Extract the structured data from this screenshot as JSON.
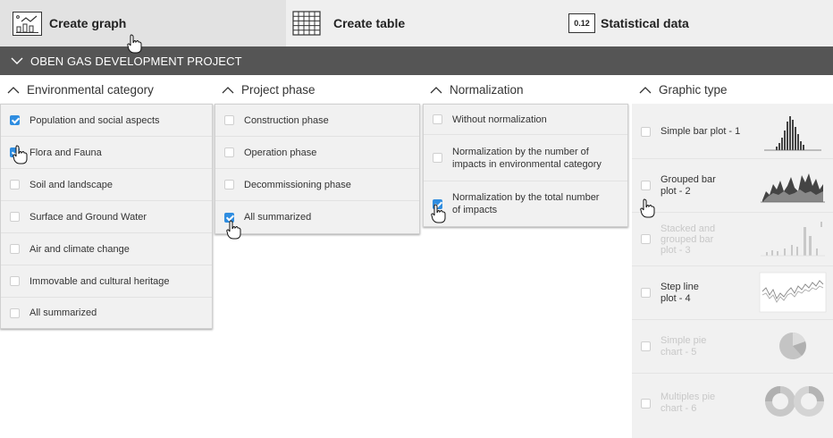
{
  "toolbar": {
    "create_graph": "Create graph",
    "create_table": "Create table",
    "statistical_data": "Statistical data",
    "stat_icon_text": "0.12"
  },
  "project": {
    "title": "OBEN GAS DEVELOPMENT PROJECT"
  },
  "columns": {
    "env": {
      "header": "Environmental category",
      "items": [
        {
          "label": "Population and social aspects",
          "checked": true
        },
        {
          "label": "Flora and Fauna",
          "checked": true
        },
        {
          "label": "Soil and landscape",
          "checked": false
        },
        {
          "label": "Surface and Ground Water",
          "checked": false
        },
        {
          "label": "Air and climate change",
          "checked": false
        },
        {
          "label": "Immovable and cultural heritage",
          "checked": false
        },
        {
          "label": "All summarized",
          "checked": false
        }
      ]
    },
    "phase": {
      "header": "Project phase",
      "items": [
        {
          "label": "Construction phase",
          "checked": false
        },
        {
          "label": "Operation phase",
          "checked": false
        },
        {
          "label": "Decommissioning phase",
          "checked": false
        },
        {
          "label": "All summarized",
          "checked": true
        }
      ]
    },
    "norm": {
      "header": "Normalization",
      "items": [
        {
          "label": "Without normalization",
          "checked": false
        },
        {
          "label_line1": "Normalization by the number of",
          "label_line2": "impacts in environmental category",
          "checked": false
        },
        {
          "label_line1": "Normalization by the total number",
          "label_line2": "of impacts",
          "checked": true
        }
      ]
    },
    "graphic": {
      "header": "Graphic type",
      "items": [
        {
          "label_line1": "Simple bar plot - 1",
          "label_line2": "",
          "enabled": true,
          "icon": "simple-bar-thumbnail"
        },
        {
          "label_line1": "Grouped bar",
          "label_line2": "plot - 2",
          "enabled": true,
          "icon": "grouped-bar-thumbnail"
        },
        {
          "label_line1": "Stacked and",
          "label_line2": "grouped bar",
          "label_line3": "plot - 3",
          "enabled": false,
          "icon": "stacked-bar-thumbnail"
        },
        {
          "label_line1": "Step line",
          "label_line2": "plot - 4",
          "enabled": true,
          "icon": "step-line-thumbnail"
        },
        {
          "label_line1": "Simple pie",
          "label_line2": "chart - 5",
          "enabled": false,
          "icon": "pie-thumbnail"
        },
        {
          "label_line1": "Multiples pie",
          "label_line2": "chart - 6",
          "enabled": false,
          "icon": "donut-thumbnail"
        }
      ]
    }
  },
  "colors": {
    "accent": "#2f8de0",
    "project_bar": "#555555",
    "panel": "#f1f1f1"
  }
}
